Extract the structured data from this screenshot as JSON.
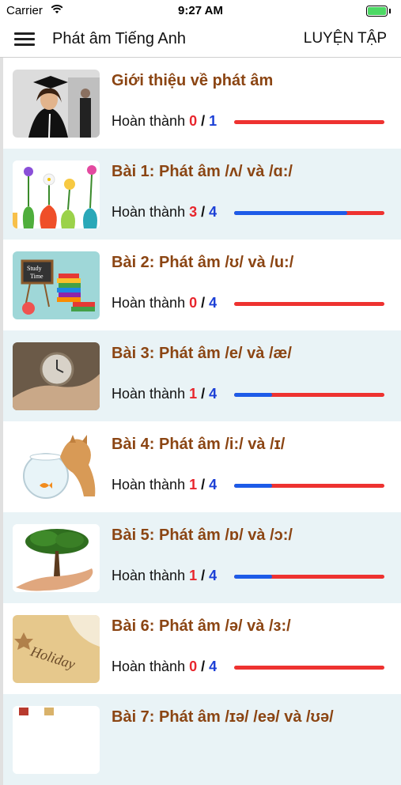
{
  "status": {
    "carrier": "Carrier",
    "time": "9:27 AM"
  },
  "nav": {
    "title": "Phát âm Tiếng Anh",
    "action": "LUYỆN TẬP"
  },
  "progress_label": "Hoàn thành",
  "lessons": [
    {
      "title": "Giới thiệu về phát âm",
      "done": "0",
      "total": "1",
      "fraction": 0,
      "thumb": "graduate-student"
    },
    {
      "title": "Bài 1: Phát âm /ʌ/ và /ɑ:/",
      "done": "3",
      "total": "4",
      "fraction": 0.75,
      "thumb": "flower-vases"
    },
    {
      "title": "Bài 2: Phát âm /ʊ/ và /u:/",
      "done": "0",
      "total": "4",
      "fraction": 0,
      "thumb": "study-time-books"
    },
    {
      "title": "Bài 3: Phát âm /e/ và /æ/",
      "done": "1",
      "total": "4",
      "fraction": 0.25,
      "thumb": "clock-in-hand"
    },
    {
      "title": "Bài 4: Phát âm /i:/ và /ɪ/",
      "done": "1",
      "total": "4",
      "fraction": 0.25,
      "thumb": "cat-fishbowl"
    },
    {
      "title": "Bài 5: Phát âm /ɒ/ và /ɔ:/",
      "done": "1",
      "total": "4",
      "fraction": 0.25,
      "thumb": "tree-in-hand"
    },
    {
      "title": "Bài 6: Phát âm /ə/ và /ɜ:/",
      "done": "0",
      "total": "4",
      "fraction": 0,
      "thumb": "holiday-sand"
    },
    {
      "title": "Bài 7: Phát âm /ɪə/ /eə/ và /ʊə/",
      "done": "",
      "total": "",
      "fraction": 0,
      "thumb": "partial"
    }
  ],
  "colors": {
    "title": "#8b4513",
    "done": "#e8262d",
    "total": "#1b3fd6",
    "bar_track": "#ee3230",
    "bar_fill": "#1d5be8",
    "alt_row": "#e9f3f6"
  }
}
